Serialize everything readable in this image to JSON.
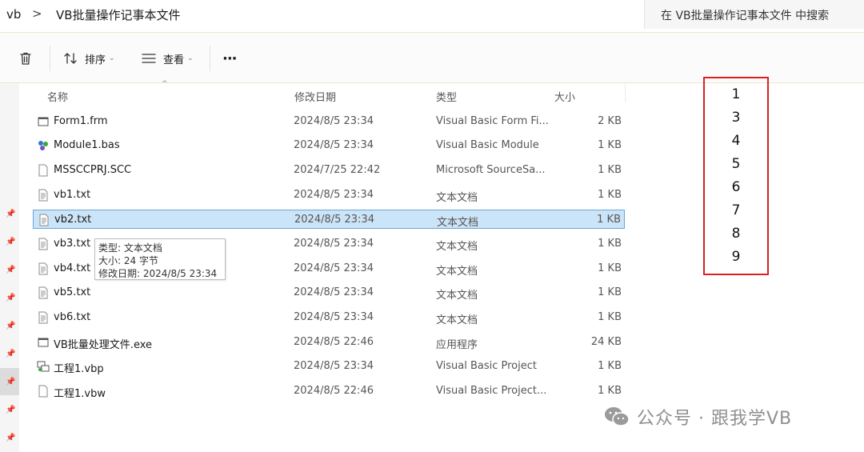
{
  "address": {
    "root": "vb",
    "separator": ">",
    "current": "VB批量操作记事本文件",
    "search_placeholder": "在 VB批量操作记事本文件 中搜索"
  },
  "toolbar": {
    "sort_label": "排序",
    "view_label": "查看",
    "more_label": "···"
  },
  "columns": {
    "name": "名称",
    "date": "修改日期",
    "type": "类型",
    "size": "大小"
  },
  "files": [
    {
      "name": "Form1.frm",
      "date": "2024/8/5 23:34",
      "type": "Visual Basic Form Fi...",
      "size": "2 KB",
      "icon": "vb-form-icon"
    },
    {
      "name": "Module1.bas",
      "date": "2024/8/5 23:34",
      "type": "Visual Basic Module",
      "size": "1 KB",
      "icon": "vb-module-icon"
    },
    {
      "name": "MSSCCPRJ.SCC",
      "date": "2024/7/25 22:42",
      "type": "Microsoft SourceSa...",
      "size": "1 KB",
      "icon": "blank-file-icon"
    },
    {
      "name": "vb1.txt",
      "date": "2024/8/5 23:34",
      "type": "文本文档",
      "size": "1 KB",
      "icon": "text-file-icon"
    },
    {
      "name": "vb2.txt",
      "date": "2024/8/5 23:34",
      "type": "文本文档",
      "size": "1 KB",
      "icon": "text-file-icon"
    },
    {
      "name": "vb3.txt",
      "date": "2024/8/5 23:34",
      "type": "文本文档",
      "size": "1 KB",
      "icon": "text-file-icon"
    },
    {
      "name": "vb4.txt",
      "date": "2024/8/5 23:34",
      "type": "文本文档",
      "size": "1 KB",
      "icon": "text-file-icon"
    },
    {
      "name": "vb5.txt",
      "date": "2024/8/5 23:34",
      "type": "文本文档",
      "size": "1 KB",
      "icon": "text-file-icon"
    },
    {
      "name": "vb6.txt",
      "date": "2024/8/5 23:34",
      "type": "文本文档",
      "size": "1 KB",
      "icon": "text-file-icon"
    },
    {
      "name": "VB批量处理文件.exe",
      "date": "2024/8/5 22:46",
      "type": "应用程序",
      "size": "24 KB",
      "icon": "exe-file-icon"
    },
    {
      "name": "工程1.vbp",
      "date": "2024/8/5 23:34",
      "type": "Visual Basic Project",
      "size": "1 KB",
      "icon": "vb-project-icon"
    },
    {
      "name": "工程1.vbw",
      "date": "2024/8/5 22:46",
      "type": "Visual Basic Project...",
      "size": "1 KB",
      "icon": "blank-file-icon"
    }
  ],
  "selected_file": "vb2.txt",
  "tooltip": {
    "type_line": "类型: 文本文档",
    "size_line": "大小: 24 字节",
    "date_line": "修改日期: 2024/8/5 23:34"
  },
  "annotation_numbers": [
    "1",
    "3",
    "4",
    "5",
    "6",
    "7",
    "8",
    "9"
  ],
  "watermark": {
    "text": "公众号 · 跟我学VB",
    "icon": "wechat-icon"
  },
  "colors": {
    "selection": "#cce4f7",
    "selection_border": "#6aa5d6",
    "annotation_box": "#e02020"
  }
}
